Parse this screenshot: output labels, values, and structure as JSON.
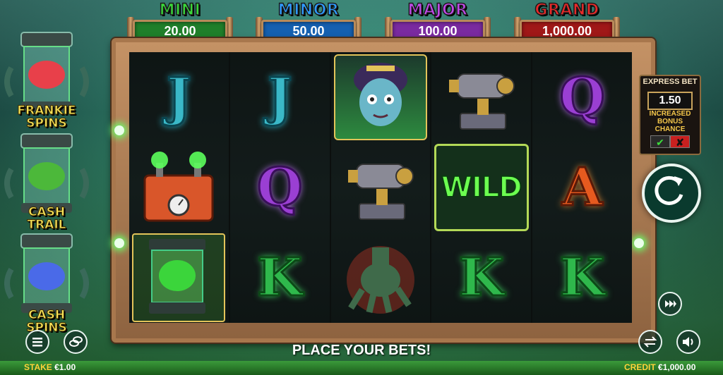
{
  "jackpots": [
    {
      "name": "MINI",
      "value": "20.00",
      "title_color": "#3ad83a",
      "bar_color": "#1f7f2a"
    },
    {
      "name": "MINOR",
      "value": "50.00",
      "title_color": "#2f9bff",
      "bar_color": "#1560b0"
    },
    {
      "name": "MAJOR",
      "value": "100.00",
      "title_color": "#c04ae8",
      "bar_color": "#7a2aa0"
    },
    {
      "name": "GRAND",
      "value": "1,000.00",
      "title_color": "#e82a2a",
      "bar_color": "#a01818"
    }
  ],
  "side_pods": [
    {
      "label_line1": "FRANKIE",
      "label_line2": "SPINS",
      "brain_color": "#e8404a"
    },
    {
      "label_line1": "CASH",
      "label_line2": "TRAIL",
      "brain_color": "#4cb83a"
    },
    {
      "label_line1": "CASH",
      "label_line2": "SPINS",
      "brain_color": "#4a6ae8"
    }
  ],
  "reels": [
    [
      "J",
      "battery-box",
      "frankie-pod"
    ],
    [
      "J",
      "Q",
      "K"
    ],
    [
      "bride",
      "tesla-coil",
      "hand"
    ],
    [
      "tesla-coil",
      "WILD",
      "K"
    ],
    [
      "Q",
      "A",
      "K"
    ]
  ],
  "express_bet": {
    "title": "EXPRESS BET",
    "value": "1.50",
    "desc_line1": "INCREASED",
    "desc_line2": "BONUS",
    "desc_line3": "CHANCE",
    "on_symbol": "✔",
    "off_symbol": "✘"
  },
  "message": "PLACE YOUR BETS!",
  "stake": {
    "label": "STAKE",
    "value": "€1.00"
  },
  "credit": {
    "label": "CREDIT",
    "value": "€1,000.00"
  },
  "icons": {
    "menu": "menu-icon",
    "coins": "coins-icon",
    "spin": "spin-icon",
    "turbo": "fast-forward-icon",
    "autoplay": "autoplay-icon",
    "sound": "sound-icon"
  }
}
